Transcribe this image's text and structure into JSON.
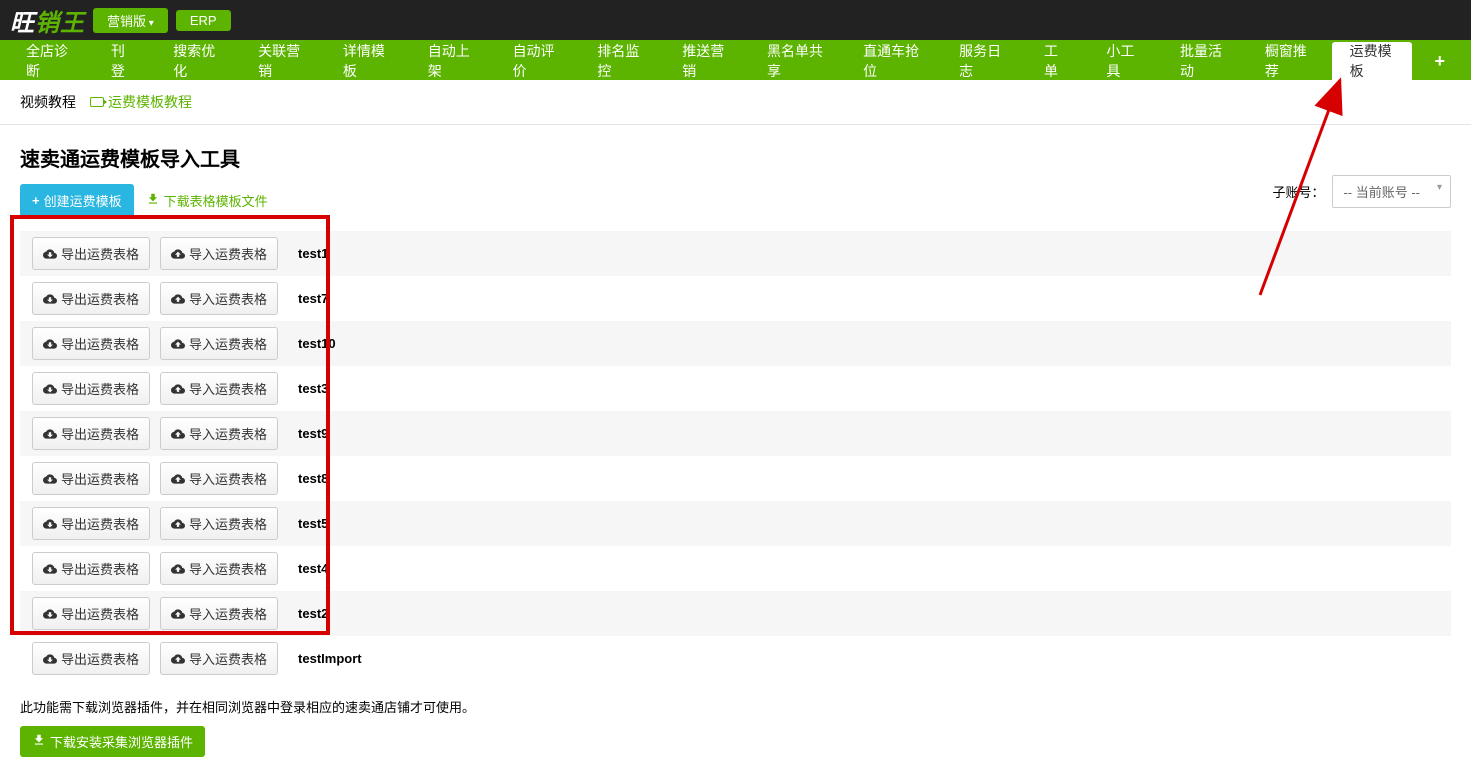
{
  "topbar": {
    "logo_white": "旺",
    "logo_green": "销王",
    "version_btn": "营销版",
    "erp_btn": "ERP"
  },
  "nav": {
    "items": [
      "全店诊断",
      "刊登",
      "搜索优化",
      "关联营销",
      "详情模板",
      "自动上架",
      "自动评价",
      "排名监控",
      "推送营销",
      "黑名单共享",
      "直通车抢位",
      "服务日志",
      "工单",
      "小工具",
      "批量活动",
      "橱窗推荐",
      "运费模板"
    ],
    "active_index": 16,
    "add": "+"
  },
  "subbar": {
    "title": "视频教程",
    "link": "运费模板教程"
  },
  "main": {
    "title": "速卖通运费模板导入工具",
    "create_btn": "创建运费模板",
    "download_link": "下载表格模板文件",
    "sub_account_label": "子账号：",
    "sub_account_selected": "-- 当前账号 --",
    "export_btn": "导出运费表格",
    "import_btn": "导入运费表格",
    "rows": [
      "test1",
      "test7",
      "test10",
      "test3",
      "test9",
      "test8",
      "test5",
      "test4",
      "test2",
      "testImport"
    ],
    "note": "此功能需下载浏览器插件，并在相同浏览器中登录相应的速卖通店铺才可使用。",
    "plugin_btn": "下载安装采集浏览器插件"
  }
}
